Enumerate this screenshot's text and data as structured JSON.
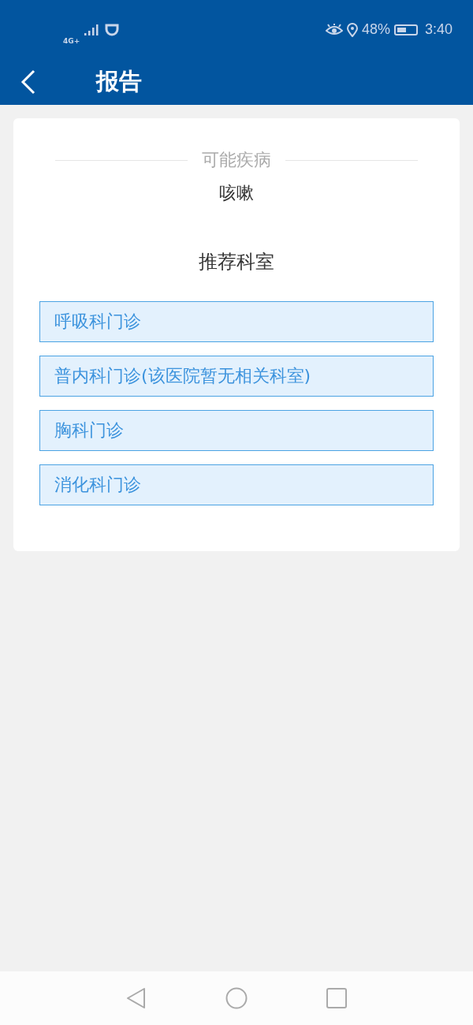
{
  "status_bar": {
    "network": "4G+",
    "battery": "48%",
    "time": "3:40"
  },
  "header": {
    "title": "报告"
  },
  "report": {
    "disease_heading": "可能疾病",
    "disease": "咳嗽",
    "department_heading": "推荐科室",
    "departments": [
      "呼吸科门诊",
      "普内科门诊(该医院暂无相关科室)",
      "胸科门诊",
      "消化科门诊"
    ]
  }
}
